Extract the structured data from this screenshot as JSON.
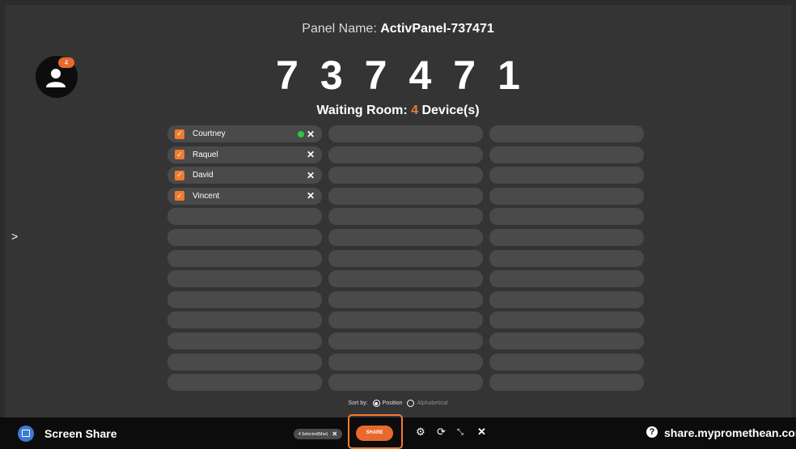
{
  "header": {
    "panel_label": "Panel Name: ",
    "panel_name": "ActivPanel-737471",
    "code": "737471",
    "waiting_label": "Waiting Room: ",
    "device_count": "4",
    "devices_suffix": " Device(s)"
  },
  "avatar": {
    "badge": "4"
  },
  "devices": [
    {
      "name": "Courtney",
      "checked": true,
      "online": true
    },
    {
      "name": "Raquel",
      "checked": true,
      "online": false
    },
    {
      "name": "David",
      "checked": true,
      "online": false
    },
    {
      "name": "Vincent",
      "checked": true,
      "online": false
    }
  ],
  "sort": {
    "label": "Sort by:",
    "options": [
      "Position",
      "Alphabetical"
    ],
    "selected": "Position"
  },
  "bottom_bar": {
    "app_title": "Screen Share",
    "selected_text": "4 Selected(Max)",
    "share_label": "SHARE",
    "url": "share.mypromethean.com"
  },
  "colors": {
    "accent": "#f07b2e",
    "online": "#31c24a"
  }
}
